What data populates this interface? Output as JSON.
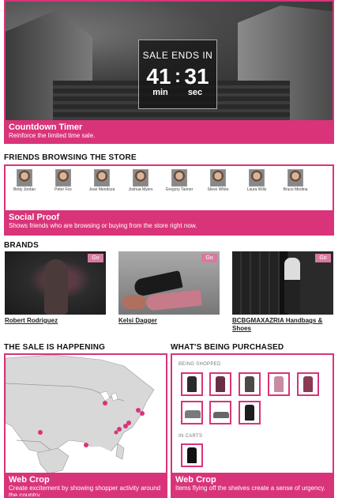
{
  "hero": {
    "timer_title": "SALE ENDS IN",
    "minutes": "41",
    "seconds": "31",
    "min_label": "min",
    "sec_label": "sec",
    "caption_title": "Countdown Timer",
    "caption_text": "Reinforce the limited time sale."
  },
  "friends": {
    "heading": "FRIENDS BROWSING THE STORE",
    "people": [
      "Betty Jordan",
      "Peter Fox",
      "Jean Mendoza",
      "Joshua Myers",
      "Gregory Tanner",
      "Steve White",
      "Laura Wills",
      "Bruce Medina"
    ],
    "caption_title": "Social Proof",
    "caption_text": "Shows friends who are browsing or buying from the store right now."
  },
  "brands": {
    "heading": "BRANDS",
    "go_label": "Go",
    "items": [
      {
        "name": "Robert Rodriguez"
      },
      {
        "name": "Kelsi Dagger"
      },
      {
        "name": "BCBGMAXAZRIA Handbags & Shoes"
      }
    ]
  },
  "sale": {
    "heading": "THE SALE IS HAPPENING",
    "caption_title": "Web Crop",
    "caption_text": "Create excitement by showing shopper activity around the country."
  },
  "purchased": {
    "heading": "WHAT'S BEING PURCHASED",
    "being_shopped_label": "BEING SHOPPED",
    "in_carts_label": "IN CARTS",
    "caption_title": "Web Crop",
    "caption_text": "Items flying off the shelves create a sense of urgency."
  },
  "colors": {
    "accent": "#d9347a"
  }
}
